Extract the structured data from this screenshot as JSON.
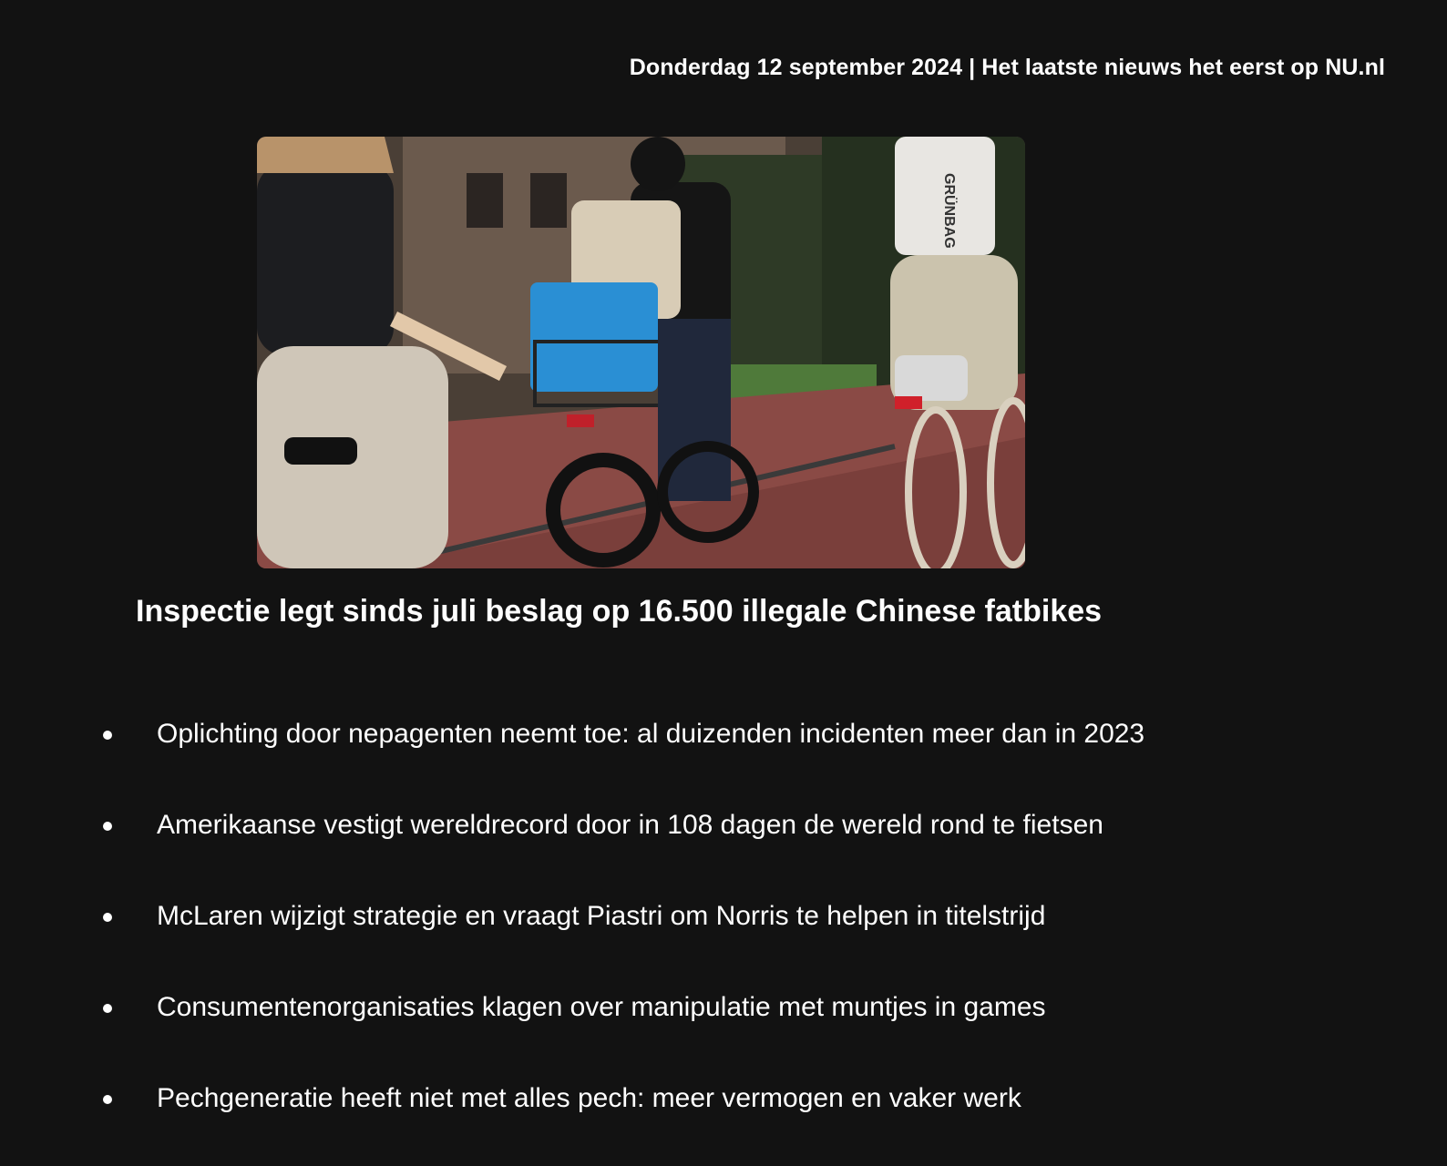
{
  "header": {
    "dateline": "Donderdag 12 september 2024 | Het laatste nieuws het eerst op NU.nl"
  },
  "hero": {
    "image_description_icon": "photo-cyclists",
    "bag_text": "GRÜNBAG",
    "headline": "Inspectie legt sinds juli beslag op 16.500 illegale Chinese fatbikes"
  },
  "news": [
    {
      "title": "Oplichting door nepagenten neemt toe: al duizenden incidenten meer dan in 2023"
    },
    {
      "title": "Amerikaanse vestigt wereldrecord door in 108 dagen de wereld rond te fietsen"
    },
    {
      "title": "McLaren wijzigt strategie en vraagt Piastri om Norris te helpen in titelstrijd"
    },
    {
      "title": "Consumentenorganisaties klagen over manipulatie met muntjes in games"
    },
    {
      "title": "Pechgeneratie heeft niet met alles pech: meer vermogen en vaker werk"
    }
  ],
  "colors": {
    "background": "#121212",
    "text": "#ffffff"
  }
}
